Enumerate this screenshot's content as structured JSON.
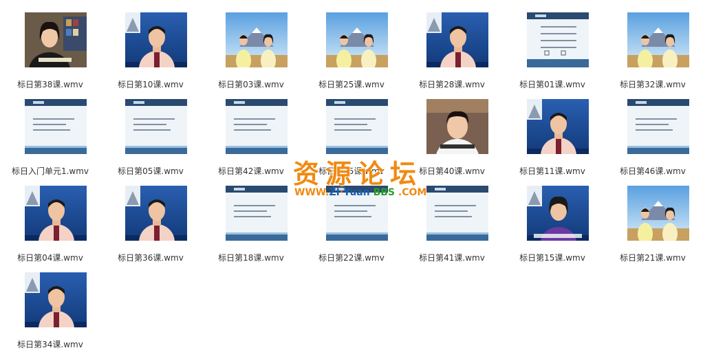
{
  "files": [
    {
      "name": "标日第38课.wmv",
      "thumb": "woman-office"
    },
    {
      "name": "标日第10课.wmv",
      "thumb": "man-blue"
    },
    {
      "name": "标日第03课.wmv",
      "thumb": "two-hosts"
    },
    {
      "name": "标日第25课.wmv",
      "thumb": "two-hosts"
    },
    {
      "name": "标日第28课.wmv",
      "thumb": "man-blue"
    },
    {
      "name": "标日第01课.wmv",
      "thumb": "slide-table"
    },
    {
      "name": "标日第32课.wmv",
      "thumb": "two-hosts"
    },
    {
      "name": "标日入门单元1.wmv",
      "thumb": "slide-text"
    },
    {
      "name": "标日第05课.wmv",
      "thumb": "slide-text"
    },
    {
      "name": "标日第42课.wmv",
      "thumb": "slide-text"
    },
    {
      "name": "标日第35课.wmv",
      "thumb": "slide-text"
    },
    {
      "name": "标日第40课.wmv",
      "thumb": "young-man"
    },
    {
      "name": "标日第11课.wmv",
      "thumb": "man-blue"
    },
    {
      "name": "标日第46课.wmv",
      "thumb": "slide-text"
    },
    {
      "name": "标日第04课.wmv",
      "thumb": "man-blue"
    },
    {
      "name": "标日第36课.wmv",
      "thumb": "man-blue"
    },
    {
      "name": "标日第18课.wmv",
      "thumb": "slide-text"
    },
    {
      "name": "标日第22课.wmv",
      "thumb": "slide-text"
    },
    {
      "name": "标日第41课.wmv",
      "thumb": "slide-text"
    },
    {
      "name": "标日第15课.wmv",
      "thumb": "woman-blue"
    },
    {
      "name": "标日第21课.wmv",
      "thumb": "two-hosts"
    },
    {
      "name": "标日第34课.wmv",
      "thumb": "man-blue"
    }
  ],
  "watermark": {
    "cn": "资源论坛",
    "url_www": "WWW.",
    "url_zi": "ZI",
    "url_yuan": "Yuan",
    "url_bbs": "BBS",
    "url_com": ".COM"
  },
  "colors": {
    "label": "#333333",
    "watermark_orange": "#f08a12",
    "watermark_blue": "#1a5fb4",
    "watermark_green": "#2a9d2a"
  }
}
